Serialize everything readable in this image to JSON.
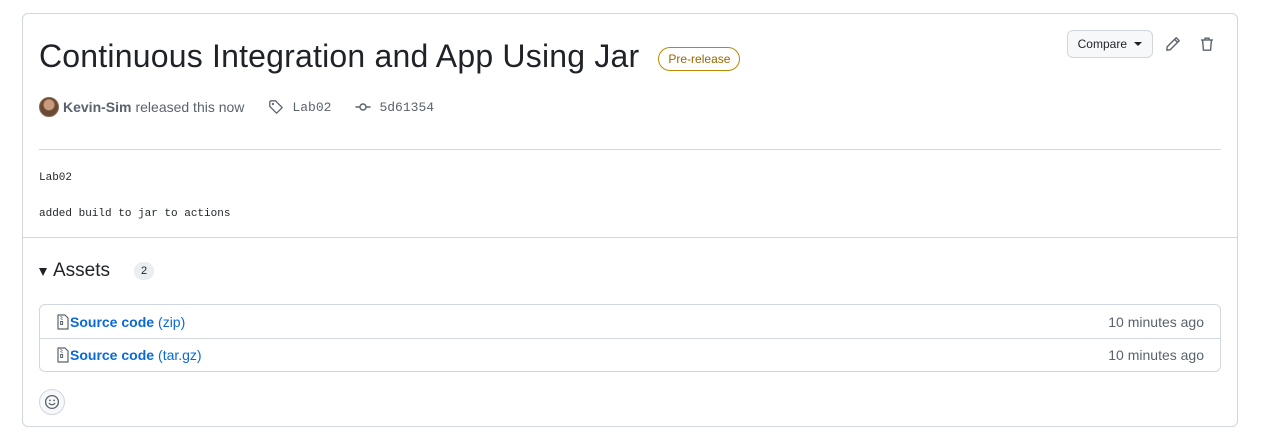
{
  "release": {
    "title": "Continuous Integration and App Using Jar",
    "badge": "Pre-release",
    "author": "Kevin-Sim",
    "released_text": "released this now",
    "tag": "Lab02",
    "commit": "5d61354",
    "notes": [
      "Lab02",
      "added build to jar to actions"
    ]
  },
  "actions": {
    "compare_label": "Compare",
    "edit_icon": "pencil-icon",
    "delete_icon": "trash-icon"
  },
  "assets": {
    "title": "Assets",
    "count": "2",
    "items": [
      {
        "name": "Source code",
        "ext": "(zip)",
        "time": "10 minutes ago"
      },
      {
        "name": "Source code",
        "ext": "(tar.gz)",
        "time": "10 minutes ago"
      }
    ]
  },
  "colors": {
    "link": "#0969da",
    "badge": "#9a6700",
    "border": "#d0d7de"
  }
}
